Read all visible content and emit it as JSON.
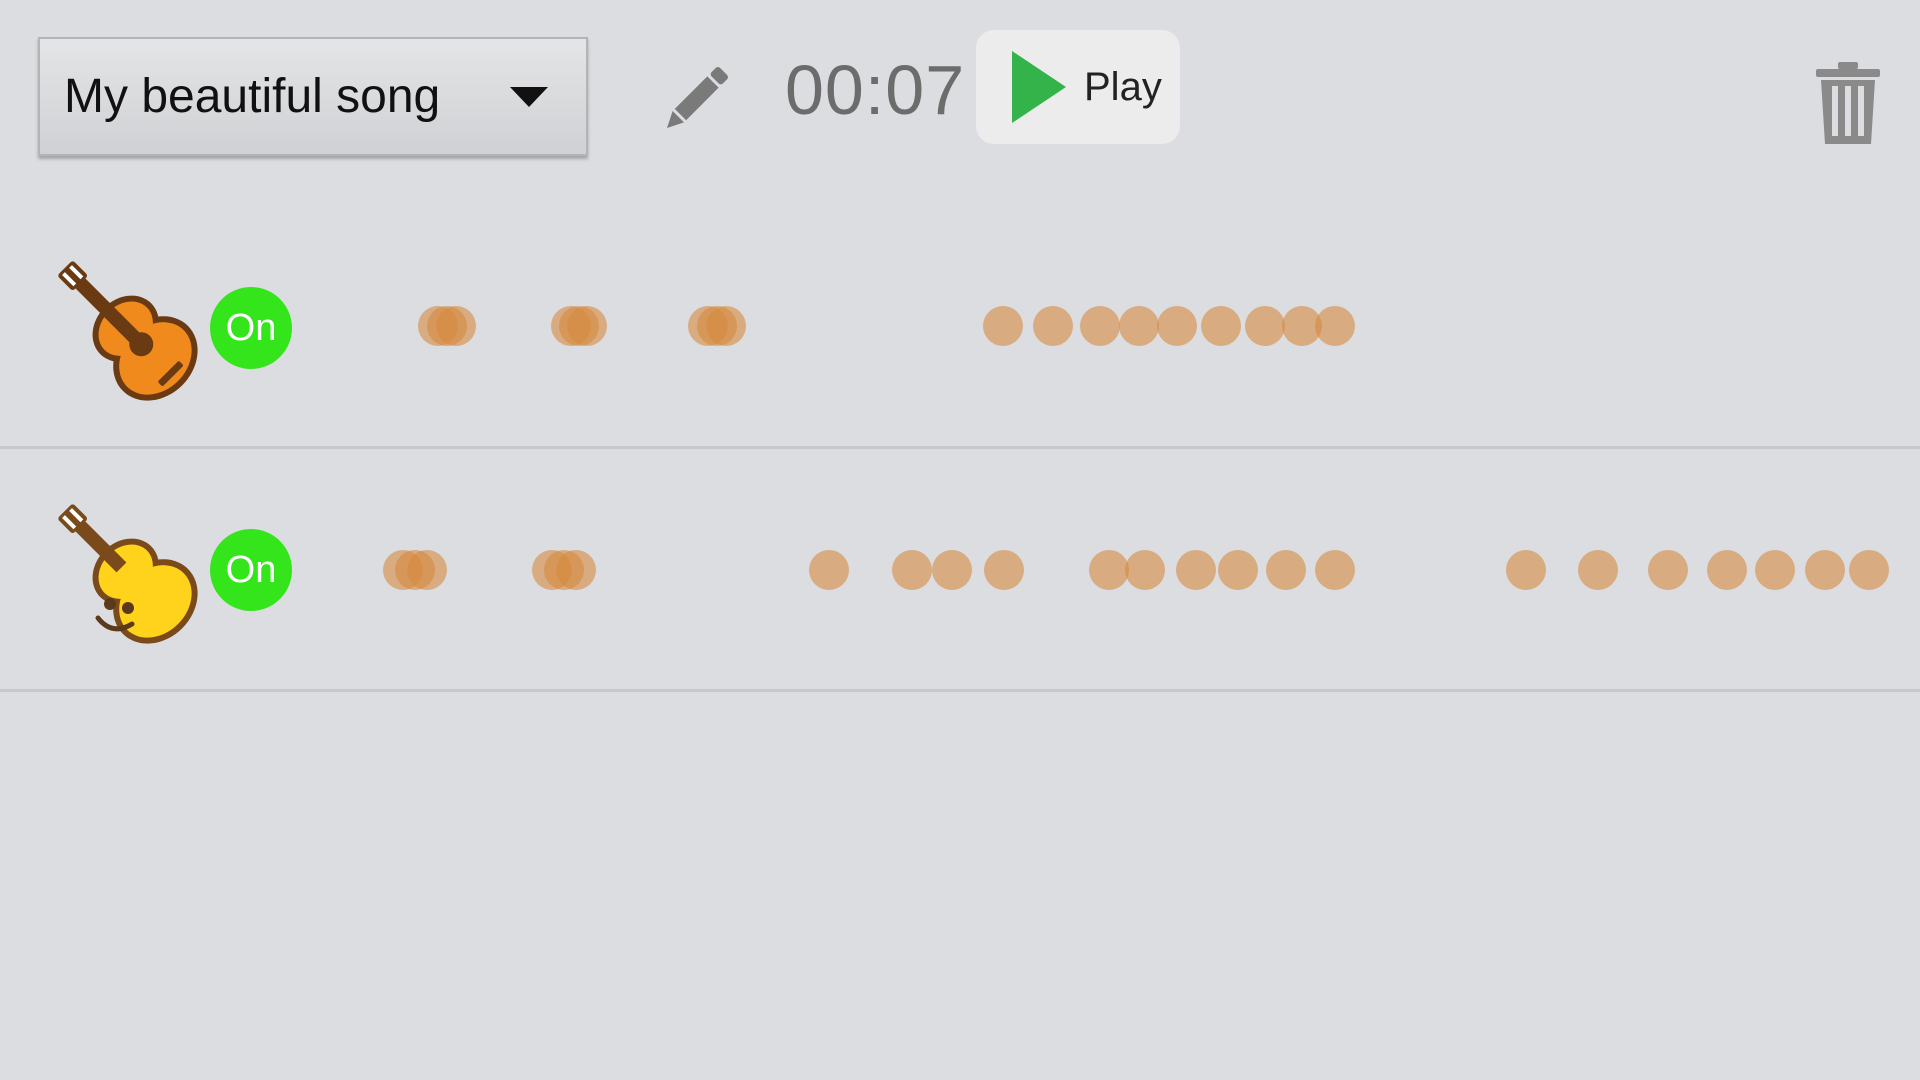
{
  "toolbar": {
    "song_title": "My beautiful song",
    "timer": "00:07",
    "play_label": "Play",
    "icons": {
      "dropdown": "chevron-down-icon",
      "edit": "pencil-icon",
      "play": "play-icon",
      "trash": "trash-icon"
    }
  },
  "colors": {
    "background": "#dcdde0",
    "on_toggle": "#34e51c",
    "play_icon": "#33b34a",
    "note": "#d58b40"
  },
  "tracks": [
    {
      "instrument": "acoustic-guitar-icon",
      "toggle_label": "On"
    },
    {
      "instrument": "ukulele-smiley-icon",
      "toggle_label": "On"
    }
  ]
}
